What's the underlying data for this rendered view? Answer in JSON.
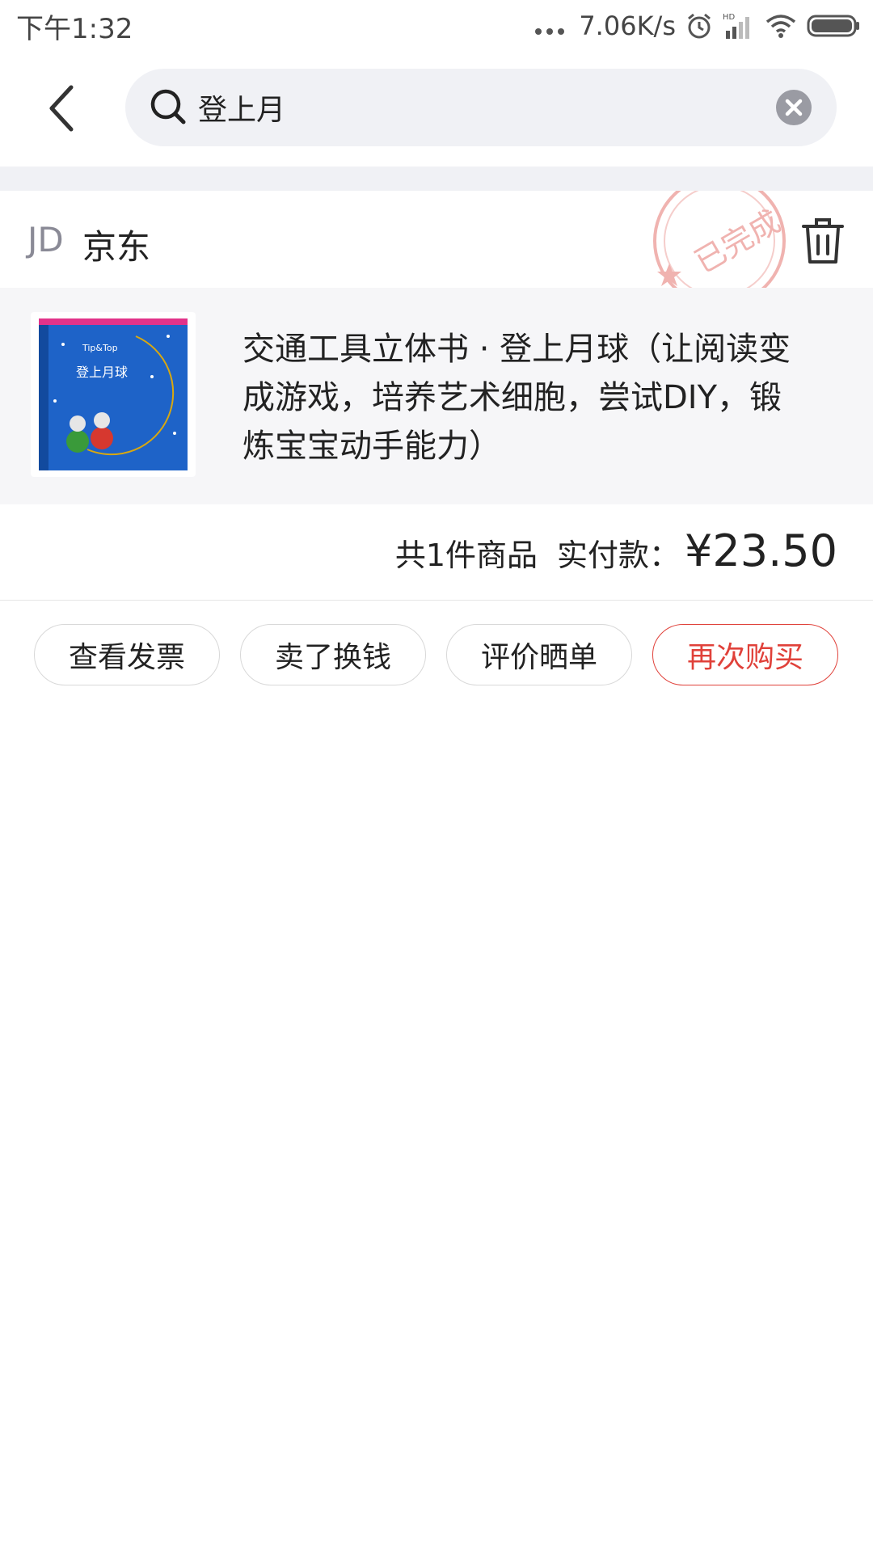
{
  "status_bar": {
    "time": "下午1:32",
    "network_speed": "7.06K/s",
    "icons": [
      "more-dots-icon",
      "alarm-icon",
      "hd-signal-icon",
      "wifi-icon",
      "battery-icon"
    ]
  },
  "header": {
    "back_icon": "chevron-left-icon",
    "search": {
      "value": "登上月",
      "icon": "search-icon",
      "clear_icon": "clear-circle-icon"
    }
  },
  "order": {
    "shop_logo": "JD",
    "shop_name": "京东",
    "status_stamp": "已完成",
    "delete_icon": "trash-icon",
    "product": {
      "title": "交通工具立体书 · 登上月球（让阅读变成游戏，培养艺术细胞，尝试DIY，锻炼宝宝动手能力）",
      "cover_title": "登上月球",
      "cover_brand": "Tip&Top"
    },
    "item_count": "共1件商品",
    "paid_label": "实付款：",
    "paid_amount": "¥23.50",
    "actions": [
      {
        "label": "查看发票"
      },
      {
        "label": "卖了换钱"
      },
      {
        "label": "评价晒单"
      },
      {
        "label": "再次购买",
        "primary": true
      }
    ]
  },
  "colors": {
    "accent_red": "#e0413a",
    "search_bg": "#f0f1f5",
    "product_bg": "#f6f6f8",
    "stamp": "#f0b3b0"
  }
}
